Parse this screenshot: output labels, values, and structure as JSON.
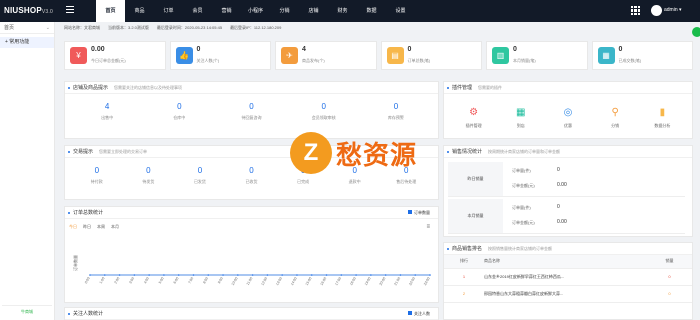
{
  "app": {
    "logo": "NIUSHOP",
    "version": "V3.0",
    "admin": "admin"
  },
  "nav": [
    "首页",
    "商品",
    "订单",
    "会员",
    "营销",
    "小程序",
    "分销",
    "店铺",
    "财务",
    "数据",
    "设置"
  ],
  "sidebar": {
    "section": "首页",
    "item": "+ 常用功能",
    "footer_logo": "牛商城"
  },
  "breadcrumb": {
    "website": "网站名称：文君商城",
    "version": "当前版本：3.2.0测试版",
    "login_time": "最后登录时间：2020-05-23 14:05:45",
    "login_ip": "最后登录IP：112.12.180.209"
  },
  "stats": [
    {
      "value": "0.00",
      "label": "今日订单总金额(元)",
      "color": "#f05a5a",
      "icon": "¥"
    },
    {
      "value": "0",
      "label": "关注人数(个)",
      "color": "#3a8ee6",
      "icon": "👍"
    },
    {
      "value": "4",
      "label": "商品发布(个)",
      "color": "#f39c3d",
      "icon": "✈"
    },
    {
      "value": "0",
      "label": "订单总数(笔)",
      "color": "#f7b74a",
      "icon": "▤"
    },
    {
      "value": "0",
      "label": "本月销量(笔)",
      "color": "#2fc7a0",
      "icon": "▥"
    },
    {
      "value": "0",
      "label": "已成交数(笔)",
      "color": "#3bb6c9",
      "icon": "▦"
    }
  ],
  "goods": {
    "title": "店铺及商品提示",
    "sub": "您需要关注的店铺信息以及待处理事项",
    "items": [
      {
        "n": "4",
        "t": "出售中"
      },
      {
        "n": "0",
        "t": "仓库中"
      },
      {
        "n": "0",
        "t": "待回复咨询"
      },
      {
        "n": "0",
        "t": "会员领取审核"
      },
      {
        "n": "0",
        "t": "库存预警"
      }
    ]
  },
  "tools": {
    "title": "插件管理",
    "sub": "您需要的插件",
    "items": [
      {
        "t": "插件管理",
        "i": "⚙"
      },
      {
        "t": "到店",
        "i": "▦"
      },
      {
        "t": "优惠",
        "i": "◎"
      },
      {
        "t": "分销",
        "i": "⚲"
      },
      {
        "t": "数据分析",
        "i": "▮"
      }
    ]
  },
  "trade": {
    "title": "交易提示",
    "sub": "您需要立即处理的交易订单",
    "items": [
      {
        "n": "0",
        "t": "待付款"
      },
      {
        "n": "0",
        "t": "待发货"
      },
      {
        "n": "0",
        "t": "已发货"
      },
      {
        "n": "0",
        "t": "已收货"
      },
      {
        "n": "0",
        "t": "已完成"
      },
      {
        "n": "0",
        "t": "退款中"
      },
      {
        "n": "0",
        "t": "售后待处理"
      }
    ]
  },
  "sales": {
    "title": "销售情况统计",
    "sub": "按周期统计商家店铺的订单量和订单金额",
    "rows": [
      {
        "label": "昨日销量",
        "q_label": "订单量(件)",
        "q": "0",
        "m_label": "订单金额(元)",
        "m": "0.00"
      },
      {
        "label": "本月销量",
        "q_label": "订单量(件)",
        "q": "0",
        "m_label": "订单金额(元)",
        "m": "0.00"
      }
    ]
  },
  "order_chart": {
    "title": "订单总数统计",
    "legend": "订单数量",
    "tabs": [
      "今日",
      "昨日",
      "本周",
      "本月"
    ],
    "ylabel": "订单数量"
  },
  "chart_data": {
    "type": "line",
    "title": "订单总数统计",
    "x": [
      "0:00",
      "1:00",
      "2:00",
      "3:00",
      "4:00",
      "5:00",
      "6:00",
      "7:00",
      "8:00",
      "9:00",
      "10:00",
      "11:00",
      "12:00",
      "13:00",
      "14:00",
      "15:00",
      "16:00",
      "17:00",
      "18:00",
      "19:00",
      "20:00",
      "21:00",
      "22:00",
      "23:00"
    ],
    "series": [
      {
        "name": "订单数量",
        "values": [
          0,
          0,
          0,
          0,
          0,
          0,
          0,
          0,
          0,
          0,
          0,
          0,
          0,
          0,
          0,
          0,
          0,
          0,
          0,
          0,
          0,
          0,
          0,
          0
        ]
      }
    ],
    "ylabel": "订单数量"
  },
  "rank": {
    "title": "商品销售排名",
    "sub": "按照销售量统计商家店铺的订单金额",
    "head": [
      "排行",
      "商品名称",
      "销量"
    ],
    "rows": [
      {
        "r": "1",
        "name": "山东金乡2019红皮新鲜早蒜红王西红柿西瓜...",
        "q": "0"
      },
      {
        "r": "2",
        "name": "邢园特香山东大蒜粗蒜瓣白蒜红皮新鲜大蒜...",
        "q": "0"
      }
    ]
  },
  "follow": {
    "title": "关注人数统计",
    "legend": "关注人数"
  },
  "watermark": {
    "logo": "Z",
    "text": "愁资源"
  }
}
